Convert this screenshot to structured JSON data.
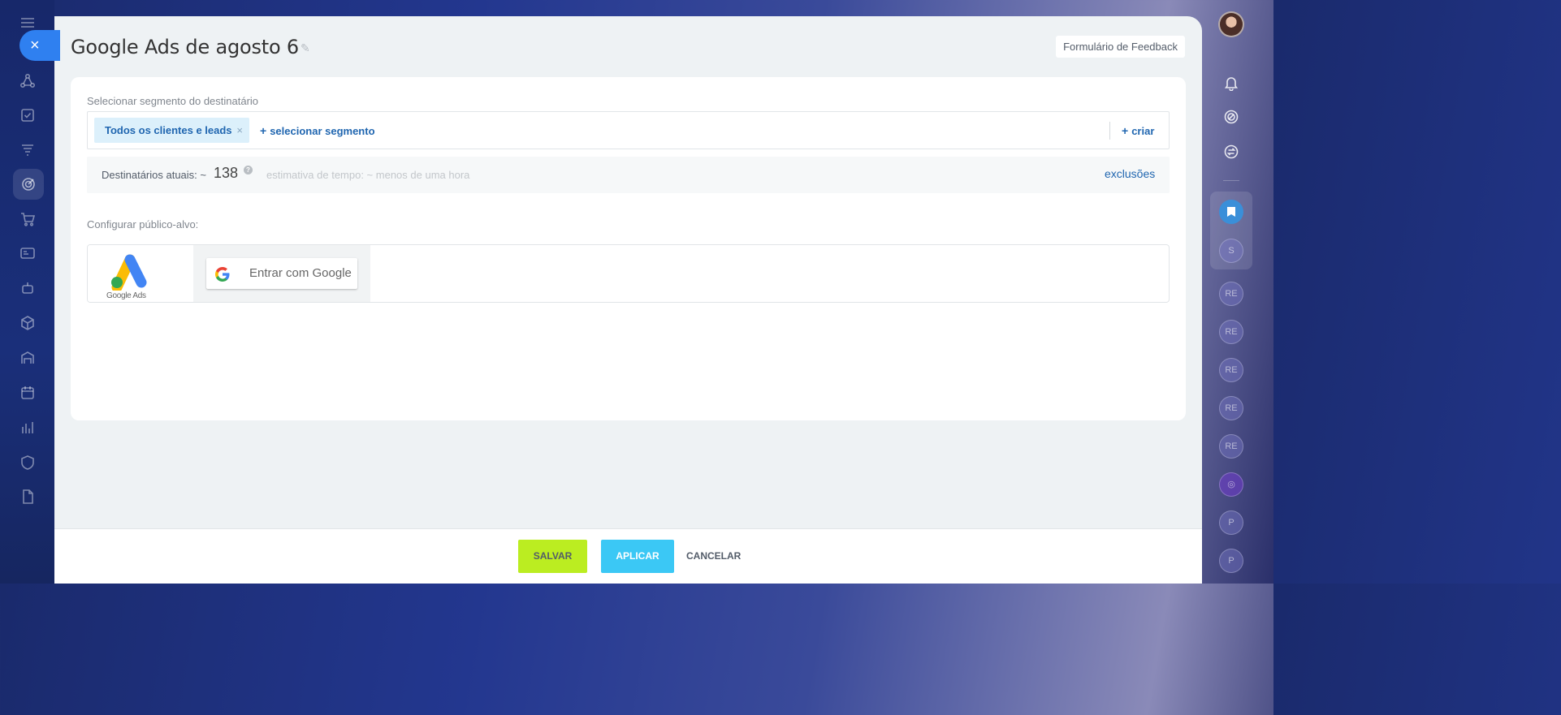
{
  "header": {
    "title": "Google Ads de agosto 6",
    "feedback_label": "Formulário de Feedback"
  },
  "segment": {
    "label": "Selecionar segmento do destinatário",
    "chip_label": "Todos os clientes e leads",
    "chip_remove": "×",
    "add_segment_label": "selecionar segmento",
    "create_label": "criar",
    "plus": "+"
  },
  "recipients": {
    "label": "Destinatários atuais: ~",
    "count": "138",
    "help": "?",
    "estimate": "estimativa de tempo: ~ menos de uma hora",
    "exclusions_label": "exclusões"
  },
  "audience": {
    "label": "Configurar público-alvo:",
    "provider_caption": "Google Ads",
    "google_signin_label": "Entrar com Google"
  },
  "footer": {
    "save_label": "SALVAR",
    "apply_label": "APLICAR",
    "cancel_label": "CANCELAR"
  },
  "nav": {
    "close": "×",
    "icons": [
      "menu-icon",
      "sitemap-icon",
      "tasks-icon",
      "funnel-icon",
      "target-icon",
      "cart-icon",
      "contact-card-icon",
      "robot-icon",
      "box-icon",
      "warehouse-icon",
      "calendar-icon",
      "chart-icon",
      "shield-icon",
      "document-icon"
    ]
  },
  "rail": {
    "circles": [
      "S",
      "RE",
      "RE",
      "RE",
      "RE",
      "RE",
      "P",
      "P"
    ]
  },
  "colors": {
    "accent_blue": "#2066b0",
    "save": "#bbed21",
    "apply": "#3bc8f5",
    "close": "#2f80f0"
  }
}
